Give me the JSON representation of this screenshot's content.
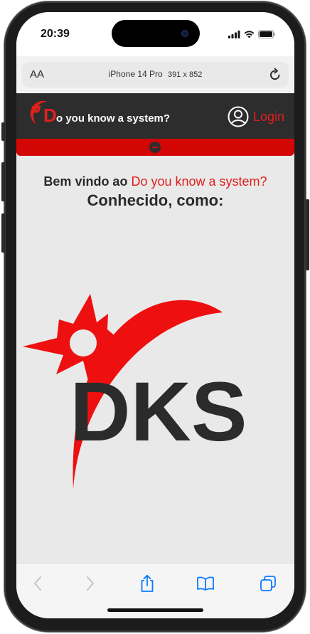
{
  "statusbar": {
    "time": "20:39"
  },
  "browser": {
    "text_size_label": "AA",
    "device_name": "iPhone 14 Pro",
    "device_dims": "391 x 852"
  },
  "site": {
    "brand": {
      "initial": "D",
      "text": "o you know a system?"
    },
    "login_label": "Login",
    "welcome_prefix": "Bem vindo ao",
    "welcome_accent": "Do you know a system?",
    "subtitle": "Conhecido, como:",
    "logo_text": "DKS"
  },
  "colors": {
    "brand_red": "#e0201c",
    "bar_red": "#d40505",
    "header_dark": "#2d2d2d",
    "content_bg": "#e9e9e9",
    "toolbar_blue": "#0a7aff"
  },
  "toolbar": {
    "buttons": [
      "back-icon",
      "forward-icon",
      "share-icon",
      "bookmarks-icon",
      "tabs-icon"
    ]
  }
}
